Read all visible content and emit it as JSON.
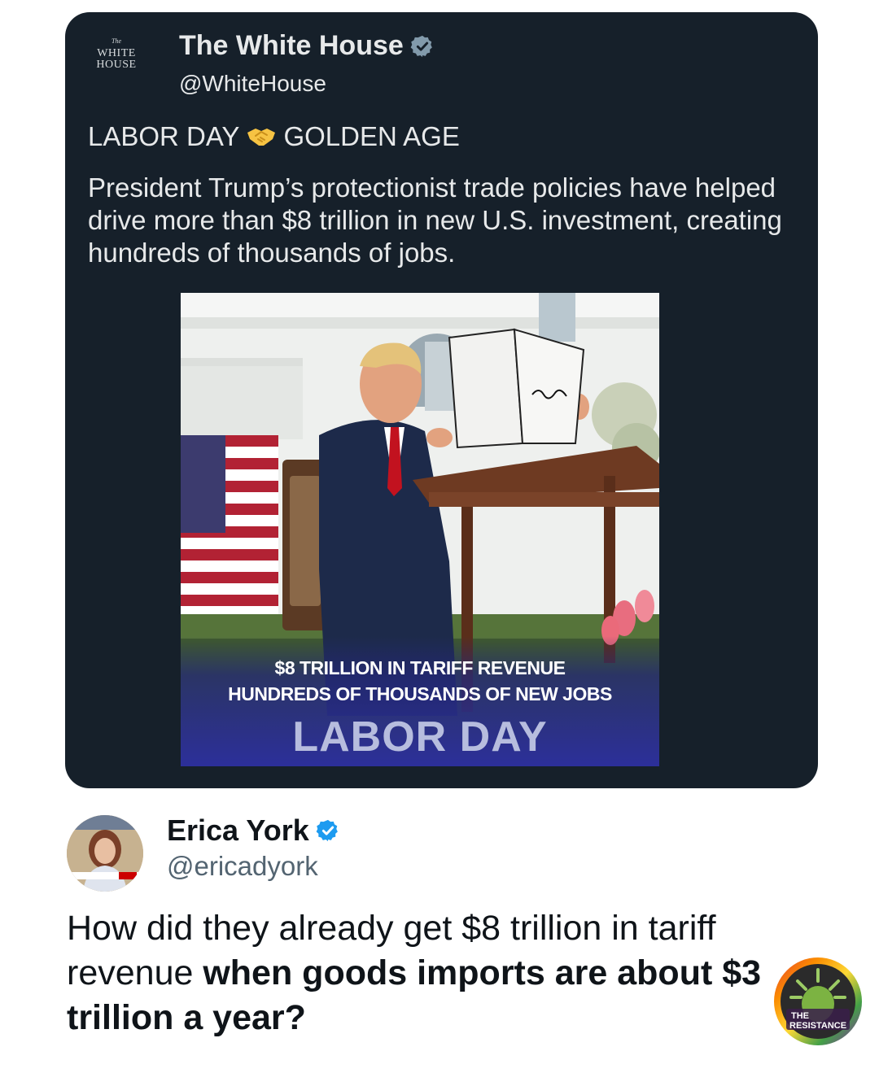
{
  "quoted_tweet": {
    "avatar_text": {
      "small": "The",
      "line1": "WHITE",
      "line2": "HOUSE"
    },
    "author_name": "The White House",
    "author_handle": "@WhiteHouse",
    "verified_icon": "verified-badge-icon",
    "headline_left": "LABOR DAY",
    "headline_emoji": "handshake-icon",
    "headline_right": "GOLDEN AGE",
    "body": "President Trump’s protectionist trade policies have helped drive more than $8 trillion in new U.S. investment, creating hundreds of thousands of jobs.",
    "media": {
      "caption_line1": "$8 TRILLION IN TARIFF REVENUE",
      "caption_line2": "HUNDREDS OF THOUSANDS OF NEW JOBS",
      "caption_line3": "LABOR DAY"
    }
  },
  "reply": {
    "author_name": "Erica York",
    "author_handle": "@ericadyork",
    "text_normal": "How did they already get $8 trillion in tariff revenue ",
    "text_bold": "when goods imports are about $3 trillion a year?"
  },
  "watermark": {
    "line1": "THE",
    "line2": "RESISTANCE"
  },
  "colors": {
    "card_bg": "#16202a",
    "verified_blue": "#1d9bf0",
    "verified_gray": "#829aab",
    "caption_blue": "#2c2f9a"
  }
}
